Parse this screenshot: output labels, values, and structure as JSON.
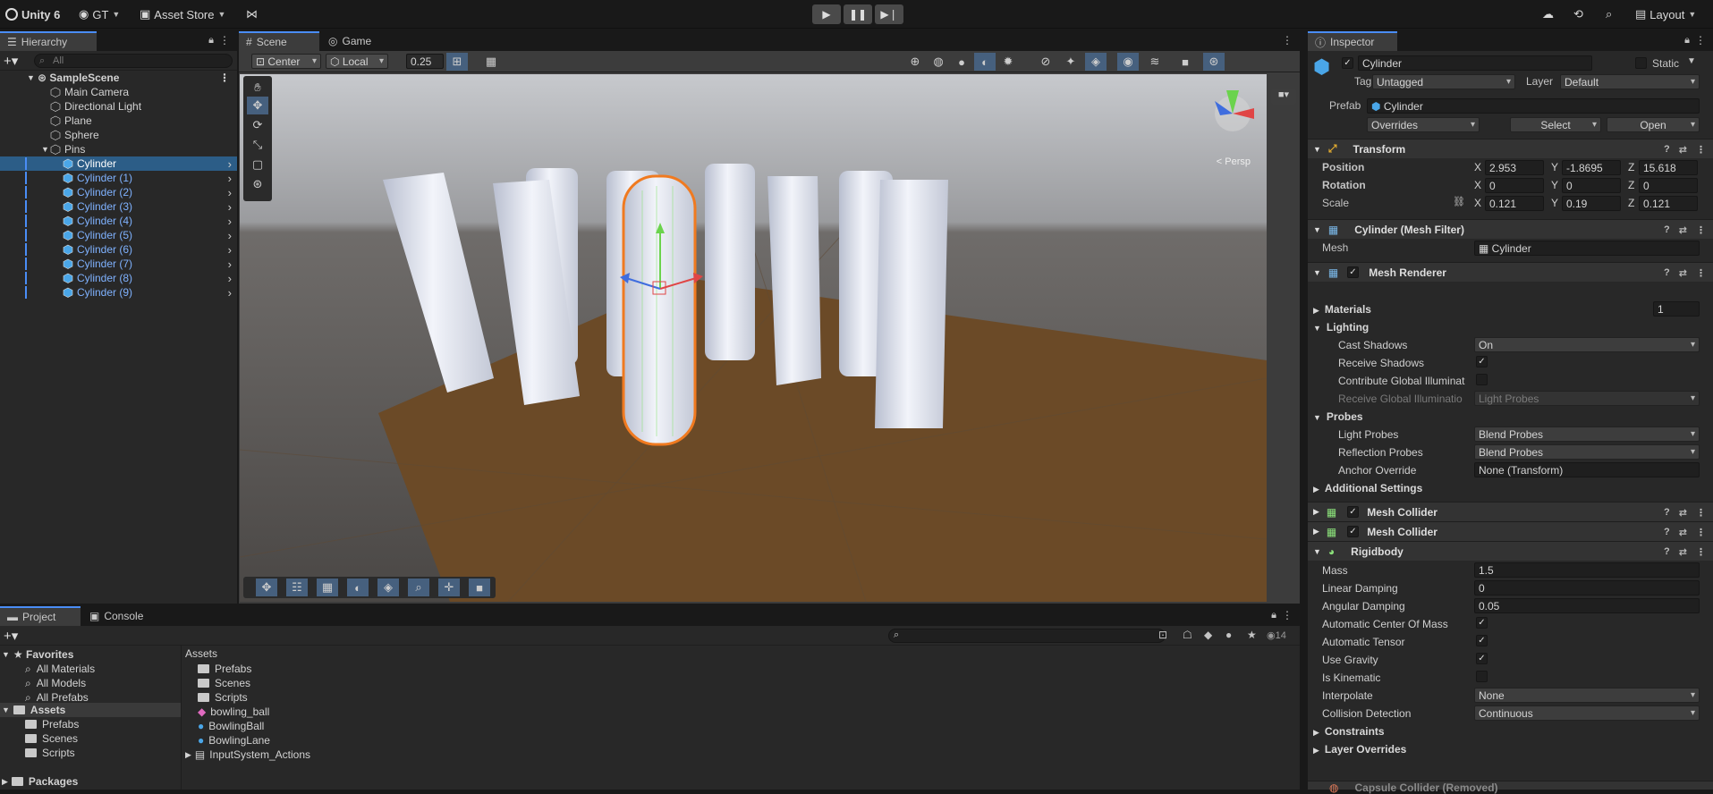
{
  "topbar": {
    "app": "Unity 6",
    "account": "GT",
    "asset_store": "Asset Store",
    "layout": "Layout"
  },
  "hierarchy": {
    "tab": "Hierarchy",
    "search_placeholder": "All",
    "scene": "SampleScene",
    "items": [
      "Main Camera",
      "Directional Light",
      "Plane",
      "Sphere",
      "Pins"
    ],
    "pins": [
      "Cylinder",
      "Cylinder (1)",
      "Cylinder (2)",
      "Cylinder (3)",
      "Cylinder (4)",
      "Cylinder (5)",
      "Cylinder (6)",
      "Cylinder (7)",
      "Cylinder (8)",
      "Cylinder (9)"
    ]
  },
  "scene": {
    "tab_scene": "Scene",
    "tab_game": "Game",
    "pivot": "Center",
    "space": "Local",
    "snap": "0.25",
    "persp": "< Persp"
  },
  "project": {
    "tab_project": "Project",
    "tab_console": "Console",
    "favorites": "Favorites",
    "fav_items": [
      "All Materials",
      "All Models",
      "All Prefabs"
    ],
    "assets": "Assets",
    "asset_folders": [
      "Prefabs",
      "Scenes",
      "Scripts"
    ],
    "packages": "Packages",
    "breadcrumb": "Assets",
    "files": [
      "Prefabs",
      "Scenes",
      "Scripts",
      "bowling_ball",
      "BowlingBall",
      "BowlingLane",
      "InputSystem_Actions"
    ],
    "count": "14"
  },
  "inspector": {
    "tab": "Inspector",
    "name": "Cylinder",
    "static": "Static",
    "tag_label": "Tag",
    "tag": "Untagged",
    "layer_label": "Layer",
    "layer": "Default",
    "prefab_label": "Prefab",
    "prefab": "Cylinder",
    "overrides": "Overrides",
    "select": "Select",
    "open": "Open",
    "transform": {
      "title": "Transform",
      "position": "Position",
      "pos": [
        "2.953",
        "-1.8695",
        "15.618"
      ],
      "rotation": "Rotation",
      "rot": [
        "0",
        "0",
        "0"
      ],
      "scale": "Scale",
      "scl": [
        "0.121",
        "0.19",
        "0.121"
      ],
      "x": "X",
      "y": "Y",
      "z": "Z"
    },
    "mesh_filter": {
      "title": "Cylinder (Mesh Filter)",
      "mesh_label": "Mesh",
      "mesh": "Cylinder"
    },
    "mesh_renderer": {
      "title": "Mesh Renderer",
      "materials": "Materials",
      "materials_count": "1",
      "lighting": "Lighting",
      "cast_shadows": "Cast Shadows",
      "cast_shadows_val": "On",
      "receive_shadows": "Receive Shadows",
      "contribute_gi": "Contribute Global Illuminat",
      "receive_gi": "Receive Global Illuminatio",
      "receive_gi_val": "Light Probes",
      "probes": "Probes",
      "light_probes": "Light Probes",
      "light_probes_val": "Blend Probes",
      "reflection_probes": "Reflection Probes",
      "reflection_probes_val": "Blend Probes",
      "anchor_override": "Anchor Override",
      "anchor_override_val": "None (Transform)",
      "additional": "Additional Settings"
    },
    "mesh_collider_1": "Mesh Collider",
    "mesh_collider_2": "Mesh Collider",
    "rigidbody": {
      "title": "Rigidbody",
      "mass": "Mass",
      "mass_val": "1.5",
      "linear_damping": "Linear Damping",
      "linear_damping_val": "0",
      "angular_damping": "Angular Damping",
      "angular_damping_val": "0.05",
      "auto_com": "Automatic Center Of Mass",
      "auto_tensor": "Automatic Tensor",
      "use_gravity": "Use Gravity",
      "is_kinematic": "Is Kinematic",
      "interpolate": "Interpolate",
      "interpolate_val": "None",
      "collision": "Collision Detection",
      "collision_val": "Continuous",
      "constraints": "Constraints",
      "layer_overrides": "Layer Overrides"
    },
    "capsule_removed": "Capsule Collider (Removed)"
  }
}
